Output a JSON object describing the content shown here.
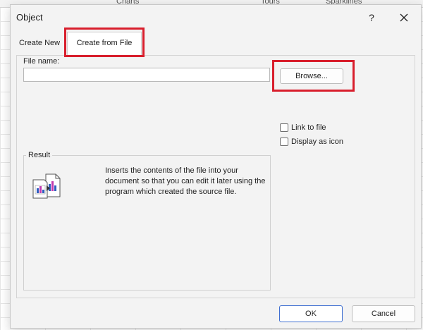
{
  "background": {
    "ribbon_labels": [
      "Charts",
      "Tours",
      "Sparklines"
    ]
  },
  "dialog": {
    "title": "Object",
    "help_label": "?",
    "tabs": [
      {
        "label": "Create New"
      },
      {
        "label": "Create from File"
      }
    ],
    "file_name_label": "File name:",
    "file_name_value": "",
    "browse_label": "Browse...",
    "checkboxes": [
      {
        "label": "Link to file",
        "checked": false
      },
      {
        "label": "Display as icon",
        "checked": false
      }
    ],
    "result": {
      "label": "Result",
      "icon": "embedded-document-icon",
      "description": "Inserts the contents of the file into your document so that you can edit it later using the program which created the source file."
    },
    "ok_label": "OK",
    "cancel_label": "Cancel"
  },
  "colors": {
    "highlight": "#d81e2c",
    "accent": "#3f6fd1",
    "dialog_bg": "#f3f3f3"
  }
}
